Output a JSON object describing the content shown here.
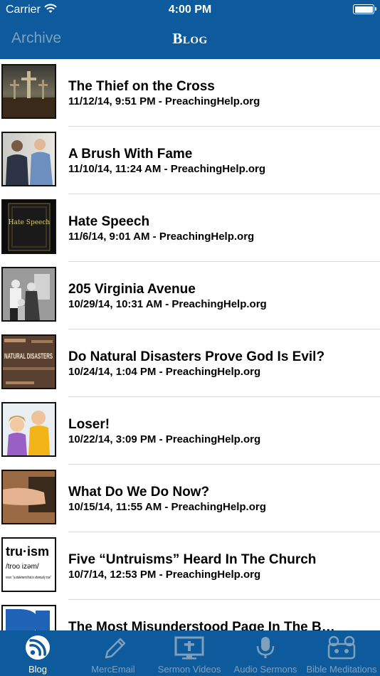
{
  "status_bar": {
    "carrier": "Carrier",
    "time": "4:00 PM"
  },
  "nav": {
    "back_label": "Archive",
    "title": "Blog"
  },
  "posts": [
    {
      "title": "The Thief on the Cross",
      "meta": "11/12/14, 9:51 PM - PreachingHelp.org"
    },
    {
      "title": "A Brush With Fame",
      "meta": "11/10/14, 11:24 AM - PreachingHelp.org"
    },
    {
      "title": "Hate Speech",
      "meta": "11/6/14, 9:01 AM - PreachingHelp.org",
      "thumb_text": "Hate Speech"
    },
    {
      "title": "205 Virginia Avenue",
      "meta": "10/29/14, 10:31 AM - PreachingHelp.org"
    },
    {
      "title": "Do Natural Disasters Prove God Is Evil?",
      "meta": "10/24/14, 1:04 PM - PreachingHelp.org",
      "thumb_text": "NATURAL DISASTERS"
    },
    {
      "title": "Loser!",
      "meta": "10/22/14, 3:09 PM - PreachingHelp.org"
    },
    {
      "title": "What Do We Do Now?",
      "meta": "10/15/14, 11:55 AM - PreachingHelp.org"
    },
    {
      "title": "Five “Untruisms” Heard In The Church",
      "meta": "10/7/14, 12:53 PM - PreachingHelp.org",
      "thumb_word": "tru·ism",
      "thumb_phon": "/troo izəm/",
      "thumb_def": "noun: \"a statement that is obviously true\""
    },
    {
      "title": "The Most Misunderstood Page In The B…",
      "meta": ""
    }
  ],
  "tabs": [
    {
      "label": "Blog",
      "icon": "rss-icon",
      "active": true
    },
    {
      "label": "MercEmail",
      "icon": "pencil-icon",
      "active": false
    },
    {
      "label": "Sermon Videos",
      "icon": "video-screen-icon",
      "active": false
    },
    {
      "label": "Audio Sermons",
      "icon": "microphone-icon",
      "active": false
    },
    {
      "label": "Bible Meditations",
      "icon": "radio-icon",
      "active": false
    }
  ],
  "colors": {
    "bar": "#0d5a9c",
    "inactive": "#7fa0bd",
    "active": "#ffffff"
  }
}
